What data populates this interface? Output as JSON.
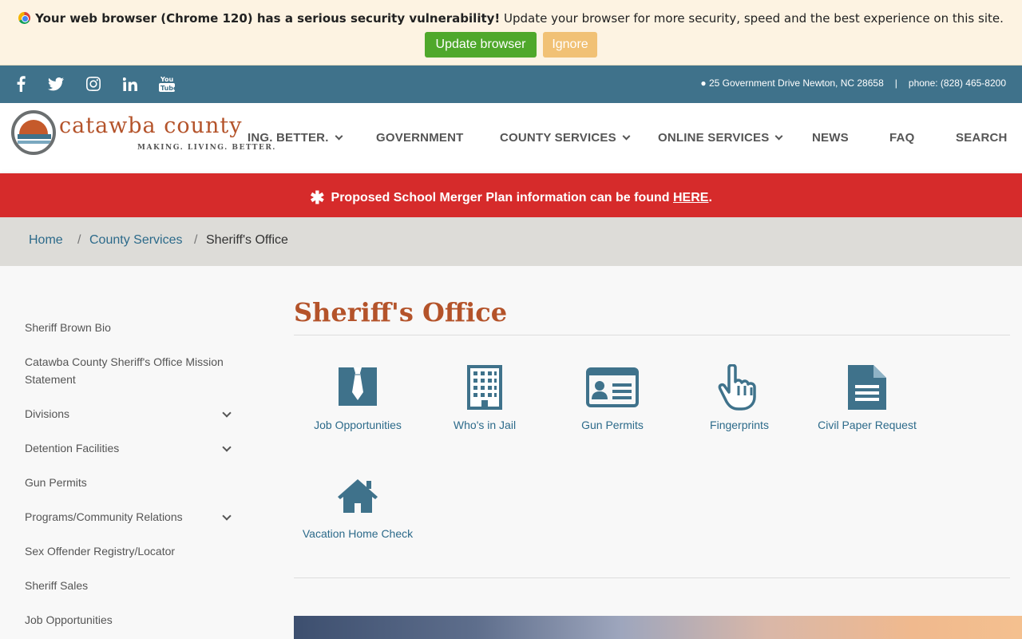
{
  "browser_warning": {
    "bold_text": "Your web browser (Chrome 120) has a serious security vulnerability!",
    "text": " Update your browser for more security, speed and the best experience on this site.",
    "update_label": "Update browser",
    "ignore_label": "Ignore"
  },
  "social": {
    "icons": [
      "facebook-icon",
      "twitter-icon",
      "instagram-icon",
      "linkedin-icon",
      "youtube-icon"
    ],
    "address": "25 Government Drive Newton, NC 28658",
    "separator": "|",
    "phone": "phone: (828) 465-8200"
  },
  "logo": {
    "name": "catawba county",
    "tagline": "MAKING. LIVING. BETTER."
  },
  "nav": {
    "items": [
      {
        "label": "ING. BETTER.",
        "dropdown": true
      },
      {
        "label": "GOVERNMENT",
        "dropdown": false
      },
      {
        "label": "COUNTY SERVICES",
        "dropdown": true
      },
      {
        "label": "ONLINE SERVICES",
        "dropdown": true
      },
      {
        "label": "NEWS",
        "dropdown": false
      },
      {
        "label": "FAQ",
        "dropdown": false
      },
      {
        "label": "SEARCH",
        "dropdown": false
      }
    ]
  },
  "alert": {
    "text": "Proposed School Merger Plan information can be found ",
    "link": "HERE",
    "end": "."
  },
  "breadcrumb": {
    "home": "Home",
    "sep": "/",
    "section": "County Services",
    "current": "Sheriff's Office"
  },
  "sidebar": {
    "items": [
      {
        "label": "Sheriff Brown Bio",
        "expandable": false
      },
      {
        "label": "Catawba County Sheriff's Office Mission Statement",
        "expandable": false
      },
      {
        "label": "Divisions",
        "expandable": true
      },
      {
        "label": "Detention Facilities",
        "expandable": true
      },
      {
        "label": "Gun Permits",
        "expandable": false
      },
      {
        "label": "Programs/Community Relations",
        "expandable": true
      },
      {
        "label": "Sex Offender Registry/Locator",
        "expandable": false
      },
      {
        "label": "Sheriff Sales",
        "expandable": false
      },
      {
        "label": "Job Opportunities",
        "expandable": false
      }
    ]
  },
  "main": {
    "title": "Sheriff's Office",
    "tiles": [
      {
        "label": "Job Opportunities",
        "icon": "tie-icon"
      },
      {
        "label": "Who's in Jail",
        "icon": "building-icon"
      },
      {
        "label": "Gun Permits",
        "icon": "id-card-icon"
      },
      {
        "label": "Fingerprints",
        "icon": "pointing-hand-icon"
      },
      {
        "label": "Civil Paper Request",
        "icon": "document-icon"
      },
      {
        "label": "Vacation Home Check",
        "icon": "home-icon"
      }
    ]
  },
  "colors": {
    "accent": "#3f728b",
    "title": "#b4532a",
    "alert": "#d62b2b",
    "link": "#2c6a8a"
  }
}
